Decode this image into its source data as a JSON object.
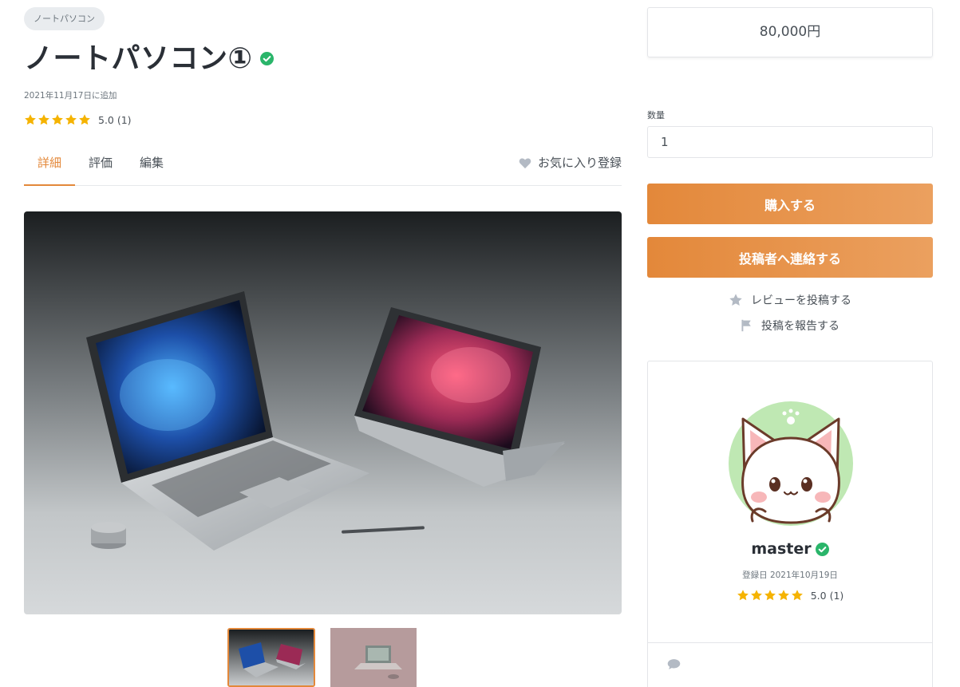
{
  "product": {
    "category": "ノートパソコン",
    "title": "ノートパソコン①",
    "added": "2021年11月17日に追加",
    "rating": "5.0 (1)",
    "stars": 5,
    "price": "80,000円"
  },
  "tabs": [
    {
      "label": "詳細",
      "active": true
    },
    {
      "label": "評価",
      "active": false
    },
    {
      "label": "編集",
      "active": false
    }
  ],
  "favorite_label": "お気に入り登録",
  "purchase": {
    "quantity_label": "数量",
    "quantity_value": "1",
    "buy_label": "購入する",
    "contact_label": "投稿者へ連絡する",
    "review_label": "レビューを投稿する",
    "report_label": "投稿を報告する"
  },
  "seller": {
    "name": "master",
    "registered": "登録日 2021年10月19日",
    "rating": "5.0 (1)",
    "stars": 5
  },
  "colors": {
    "accent": "#e3883a",
    "star": "#f5b301",
    "verified": "#2ab56a"
  },
  "icons": {
    "verified": "check-circle-icon",
    "favorite": "heart-icon",
    "review": "star-icon",
    "report": "flag-icon",
    "chat": "comment-icon"
  }
}
